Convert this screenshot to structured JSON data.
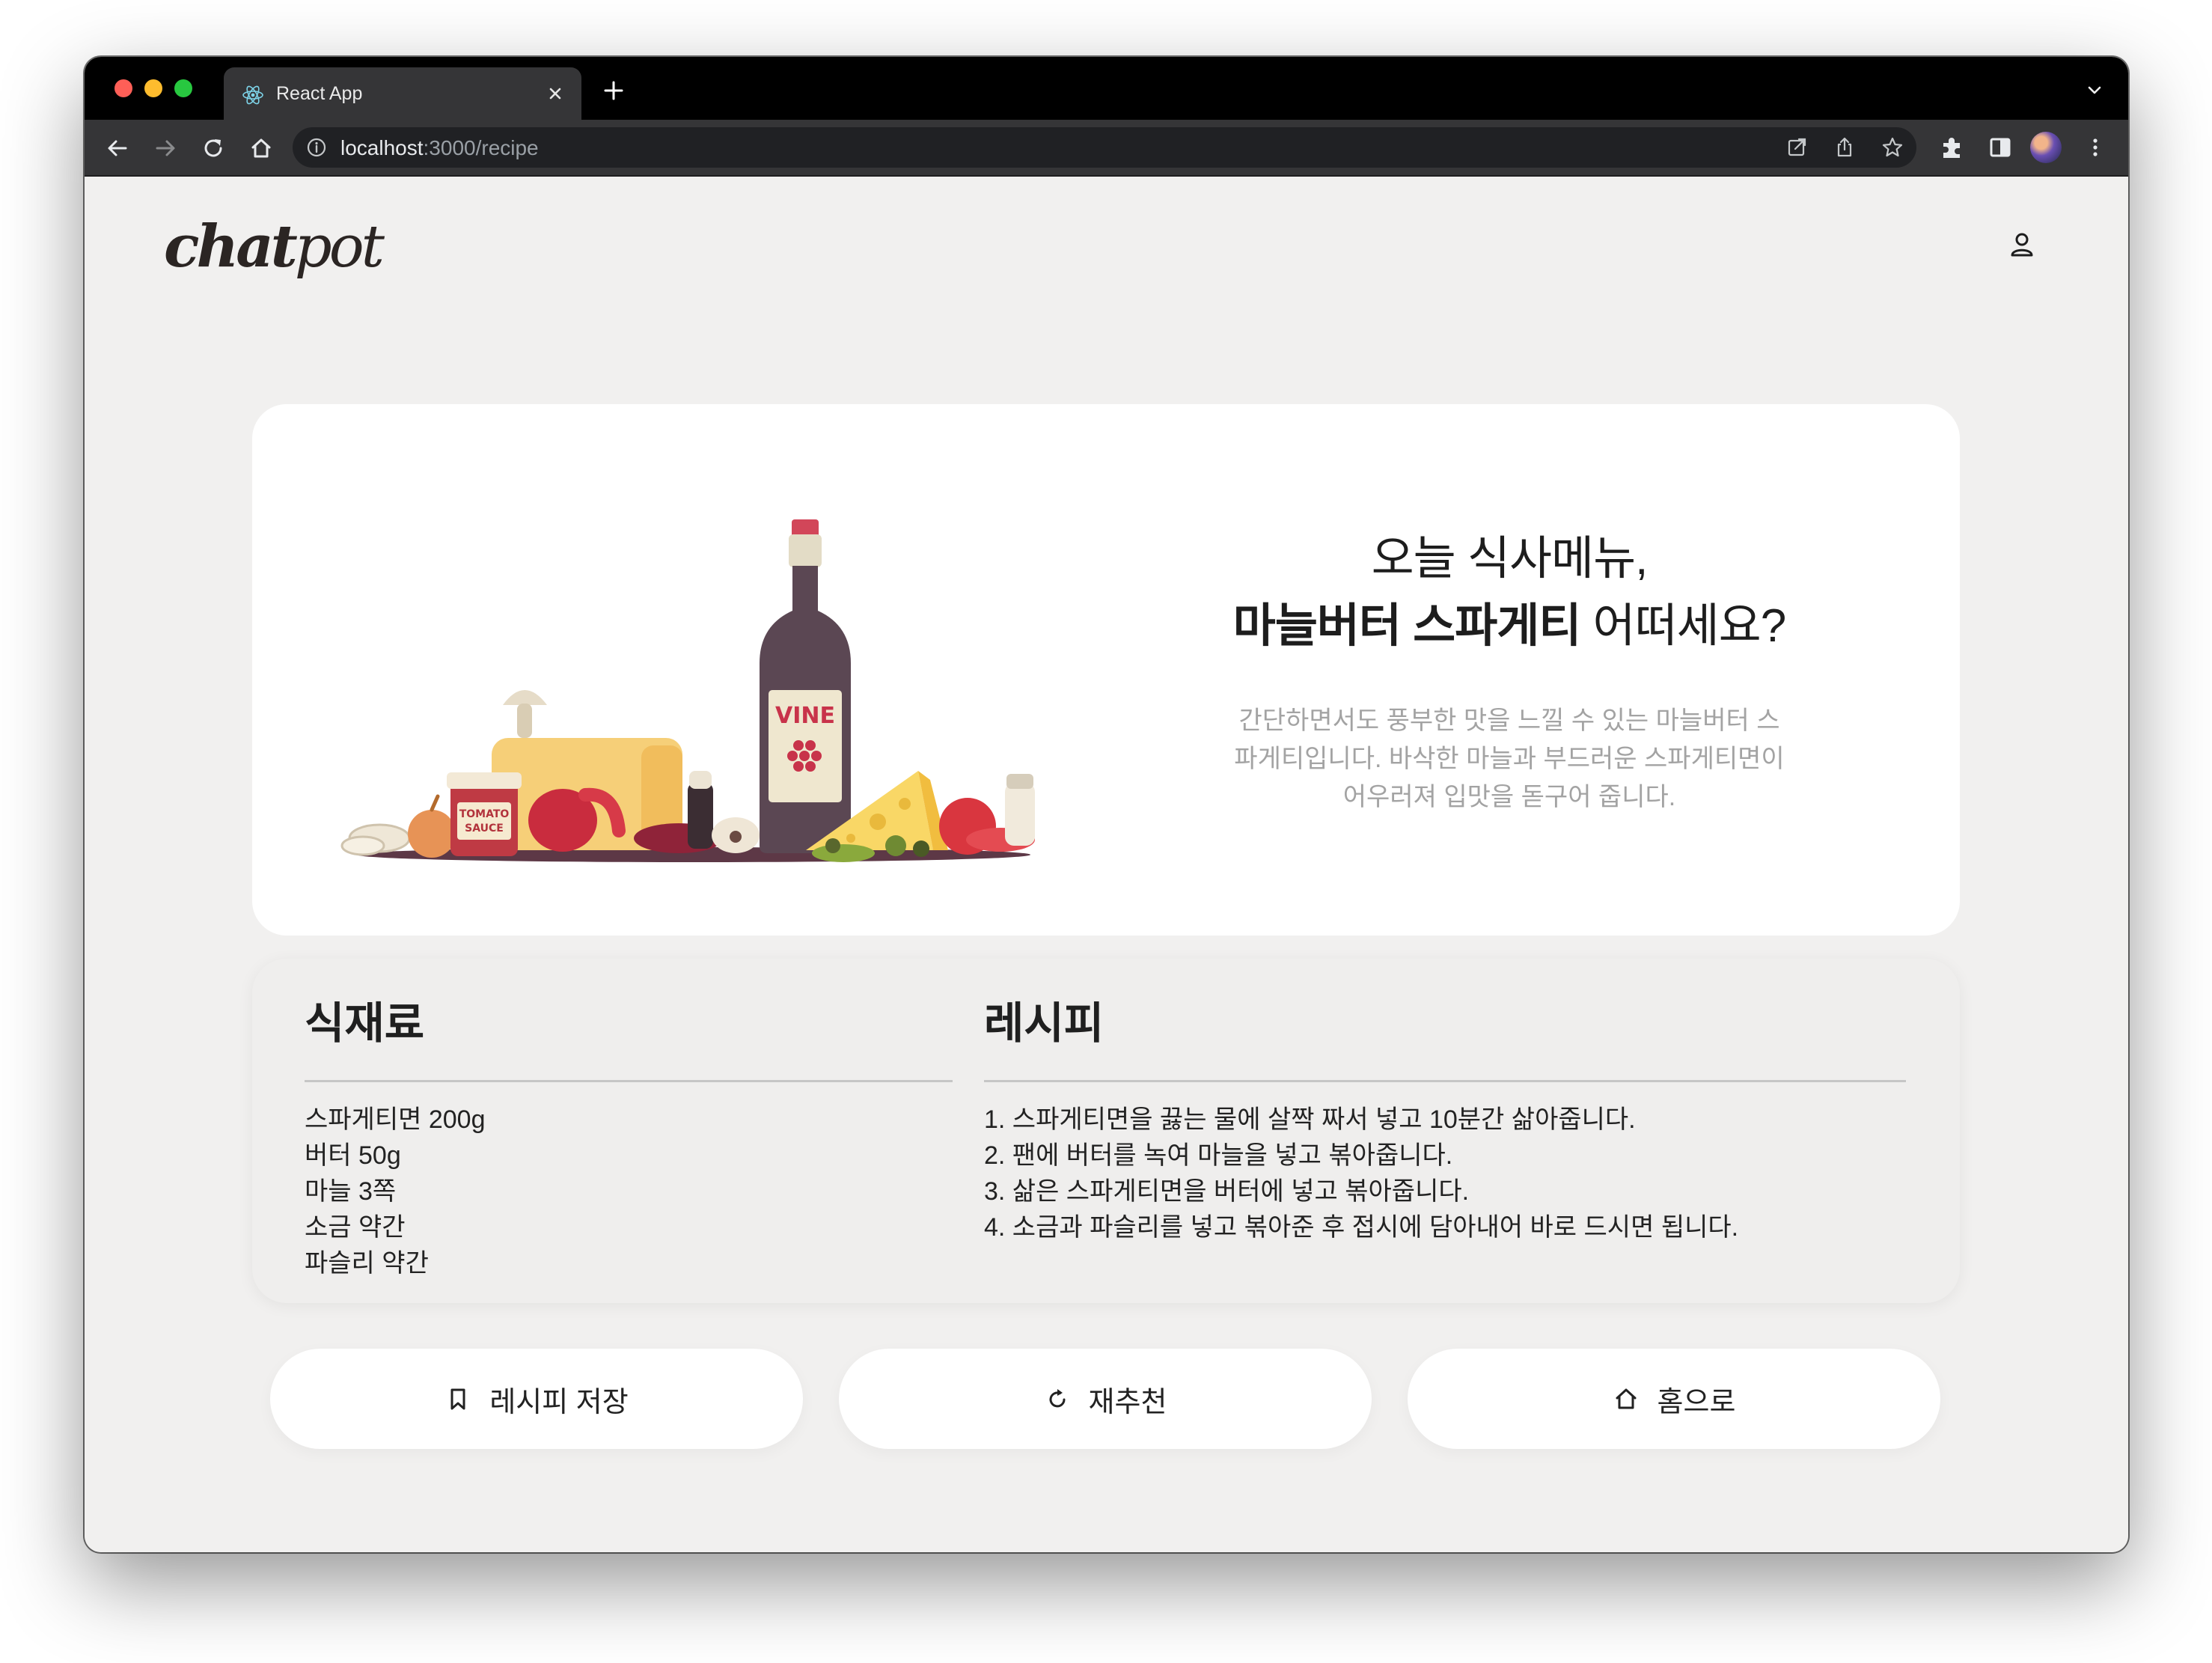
{
  "browser": {
    "tab_title": "React App",
    "url_host": "localhost",
    "url_path": ":3000/recipe"
  },
  "icons": [
    "react-favicon",
    "close-icon",
    "plus-icon",
    "chevron-down-icon",
    "back-arrow-icon",
    "forward-arrow-icon",
    "reload-icon",
    "home-icon",
    "info-icon",
    "open-in-app-icon",
    "share-icon",
    "star-icon",
    "extensions-icon",
    "side-panel-icon",
    "more-icon",
    "user-icon",
    "bookmark-icon",
    "refresh-icon"
  ],
  "app": {
    "logo_bold": "chat",
    "logo_light": "pot"
  },
  "hero": {
    "title_line1": "오늘 식사메뉴,",
    "title_dish": "마늘버터 스파게티",
    "title_suffix": " 어떠세요?",
    "description": "간단하면서도 풍부한 맛을 느낄 수 있는 마늘버터 스파게티입니다. 바삭한 마늘과 부드러운 스파게티면이 어우러져 입맛을 돋구어 줍니다.",
    "bottle_label": "VINE",
    "jar_label_1": "TOMATO",
    "jar_label_2": "SAUCE"
  },
  "ingredients": {
    "heading": "식재료",
    "items": [
      "스파게티면 200g",
      "버터 50g",
      "마늘 3쪽",
      "소금 약간",
      "파슬리 약간"
    ]
  },
  "recipe": {
    "heading": "레시피",
    "steps": [
      "1. 스파게티면을 끓는 물에 살짝 짜서 넣고 10분간 삶아줍니다.",
      "2. 팬에 버터를 녹여 마늘을 넣고 볶아줍니다.",
      "3. 삶은 스파게티면을 버터에 넣고 볶아줍니다.",
      "4. 소금과 파슬리를 넣고 볶아준 후 접시에 담아내어 바로 드시면 됩니다."
    ]
  },
  "actions": {
    "save": "레시피 저장",
    "retry": "재추천",
    "home": "홈으로"
  }
}
